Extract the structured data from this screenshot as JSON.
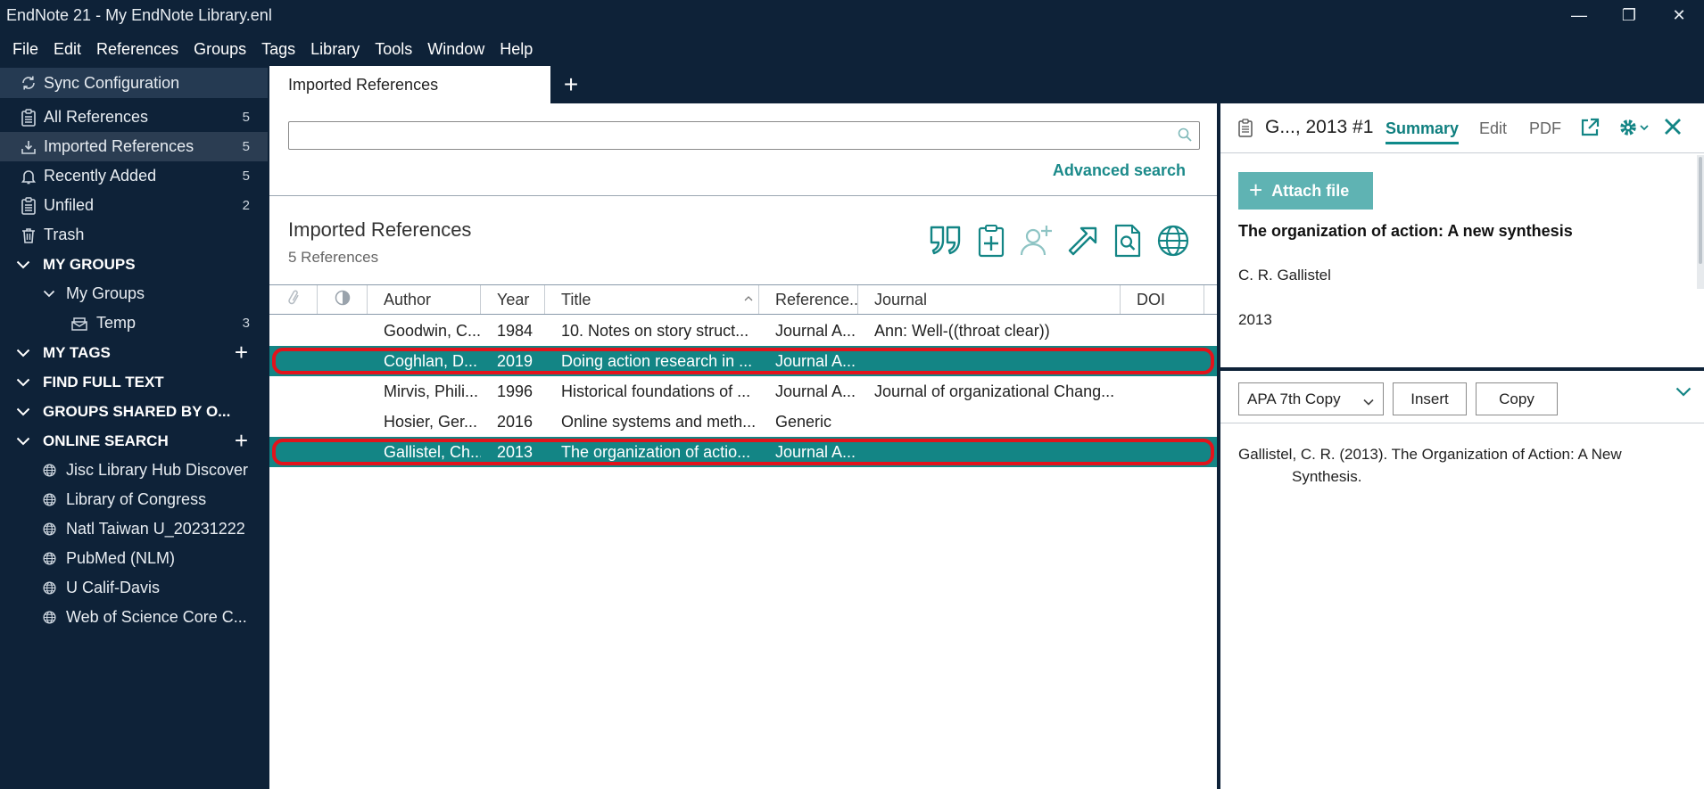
{
  "window": {
    "title": "EndNote 21 - My EndNote Library.enl",
    "controls": {
      "minimize": "—",
      "maximize": "❐",
      "close": "✕"
    }
  },
  "menu": [
    "File",
    "Edit",
    "References",
    "Groups",
    "Tags",
    "Library",
    "Tools",
    "Window",
    "Help"
  ],
  "sidebar": {
    "sync": "Sync Configuration",
    "library_items": [
      {
        "label": "All References",
        "count": "5",
        "icon": "clipboard-icon"
      },
      {
        "label": "Imported References",
        "count": "5",
        "icon": "import-icon",
        "selected": true
      },
      {
        "label": "Recently Added",
        "count": "5",
        "icon": "bell-icon"
      },
      {
        "label": "Unfiled",
        "count": "2",
        "icon": "clipboard-icon"
      },
      {
        "label": "Trash",
        "count": "",
        "icon": "trash-icon"
      }
    ],
    "my_groups": {
      "header": "MY GROUPS",
      "subgroup": "My Groups",
      "items": [
        {
          "label": "Temp",
          "count": "3",
          "icon": "group-icon"
        }
      ]
    },
    "my_tags": "MY TAGS",
    "find_full_text": "FIND FULL TEXT",
    "groups_shared": "GROUPS SHARED BY O...",
    "online_search": {
      "header": "ONLINE SEARCH",
      "items": [
        "Jisc Library Hub Discover",
        "Library of Congress",
        "Natl Taiwan U_20231222",
        "PubMed (NLM)",
        "U Calif-Davis",
        "Web of Science Core C..."
      ]
    }
  },
  "tabs": {
    "active": "Imported References",
    "add": "+"
  },
  "center": {
    "search_placeholder": "",
    "advanced_search": "Advanced search",
    "library_title": "Imported References",
    "library_count": "5 References",
    "columns": {
      "author": "Author",
      "year": "Year",
      "title": "Title",
      "reference_type": "Reference...",
      "journal": "Journal",
      "doi": "DOI"
    },
    "rows": [
      {
        "author": "Goodwin, C...",
        "year": "1984",
        "title": "10. Notes on story struct...",
        "type": "Journal A...",
        "journal": "Ann: Well-((throat clear))",
        "doi": "",
        "selected": false
      },
      {
        "author": "Coghlan, D...",
        "year": "2019",
        "title": "Doing action research in ...",
        "type": "Journal A...",
        "journal": "",
        "doi": "",
        "selected": true
      },
      {
        "author": "Mirvis, Phili...",
        "year": "1996",
        "title": "Historical foundations of ...",
        "type": "Journal A...",
        "journal": "Journal of organizational Chang...",
        "doi": "",
        "selected": false
      },
      {
        "author": "Hosier, Ger...",
        "year": "2016",
        "title": "Online systems and meth...",
        "type": "Generic",
        "journal": "",
        "doi": "",
        "selected": false
      },
      {
        "author": "Gallistel, Ch...",
        "year": "2013",
        "title": "The organization of actio...",
        "type": "Journal A...",
        "journal": "",
        "doi": "",
        "selected": true
      }
    ]
  },
  "right_panel": {
    "ref_id": "G..., 2013 #1",
    "tabs": {
      "summary": "Summary",
      "edit": "Edit",
      "pdf": "PDF"
    },
    "attach_label": "Attach file",
    "ref_title": "The organization of action: A new synthesis",
    "ref_author": "C. R. Gallistel",
    "ref_year": "2013",
    "style": "APA 7th Copy",
    "insert": "Insert",
    "copy": "Copy",
    "citation": "Gallistel, C. R. (2013). The Organization of Action: A New Synthesis."
  },
  "colors": {
    "sidebar_bg": "#0e2238",
    "accent": "#138585",
    "highlight": "#e2131b"
  }
}
